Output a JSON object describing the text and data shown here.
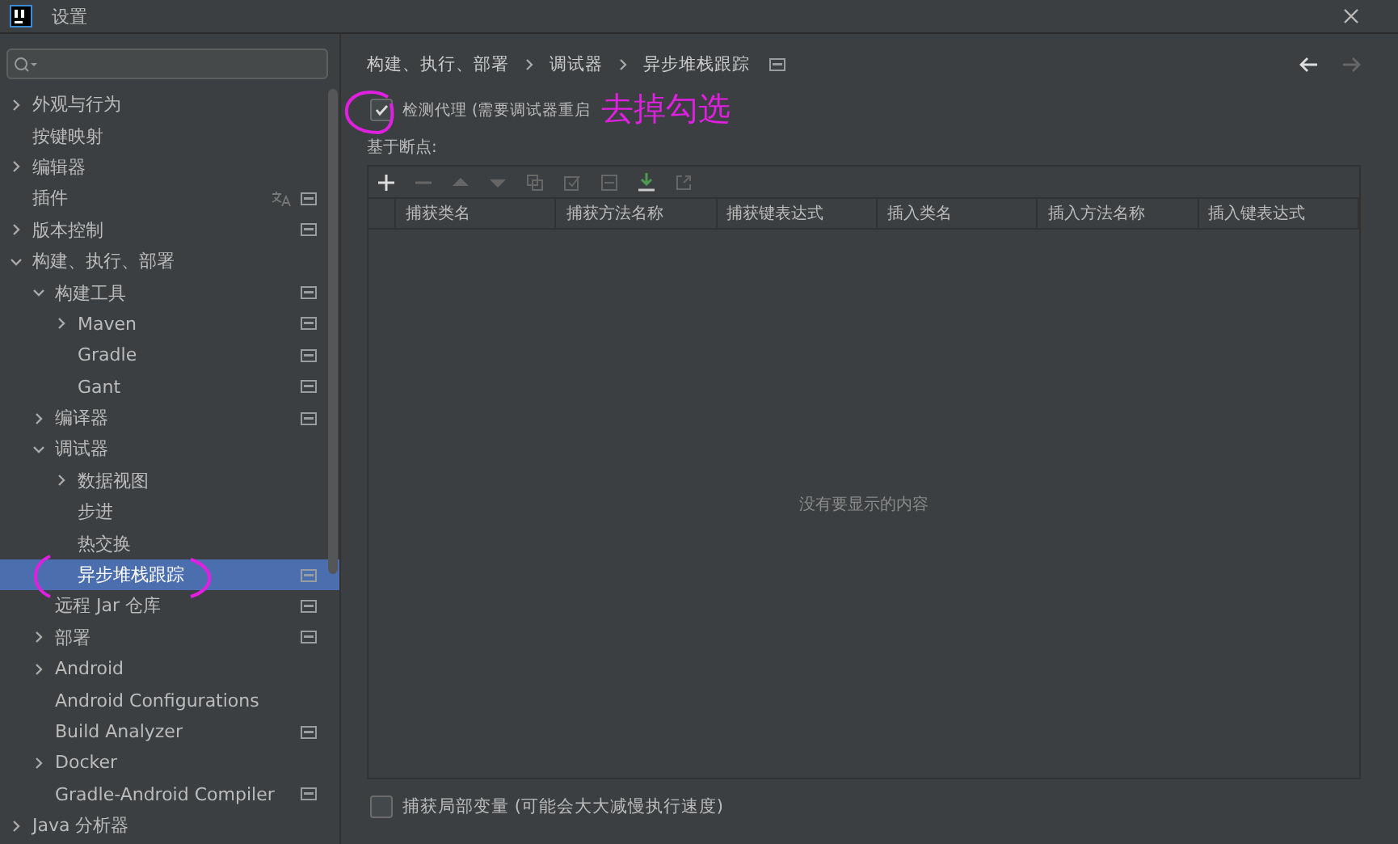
{
  "window": {
    "title": "设置"
  },
  "sidebar": {
    "items": [
      {
        "label": "外观与行为",
        "expanded": false,
        "selected": false,
        "scoped": false
      },
      {
        "label": "按键映射",
        "selected": false,
        "scoped": false
      },
      {
        "label": "编辑器",
        "expanded": false,
        "selected": false,
        "scoped": false
      },
      {
        "label": "插件",
        "selected": false,
        "scoped": true,
        "localized": true
      },
      {
        "label": "版本控制",
        "expanded": false,
        "selected": false,
        "scoped": true
      },
      {
        "label": "构建、执行、部署",
        "expanded": true,
        "selected": false,
        "scoped": false,
        "children": [
          {
            "label": "构建工具",
            "expanded": true,
            "selected": false,
            "scoped": true,
            "children": [
              {
                "label": "Maven",
                "expanded": false,
                "selected": false,
                "scoped": true
              },
              {
                "label": "Gradle",
                "selected": false,
                "scoped": true
              },
              {
                "label": "Gant",
                "selected": false,
                "scoped": true
              }
            ]
          },
          {
            "label": "编译器",
            "expanded": false,
            "selected": false,
            "scoped": true
          },
          {
            "label": "调试器",
            "expanded": true,
            "selected": false,
            "scoped": false,
            "children": [
              {
                "label": "数据视图",
                "expanded": false,
                "selected": false,
                "scoped": false
              },
              {
                "label": "步进",
                "selected": false,
                "scoped": false
              },
              {
                "label": "热交换",
                "selected": false,
                "scoped": false
              },
              {
                "label": "异步堆栈跟踪",
                "selected": true,
                "scoped": true
              }
            ]
          },
          {
            "label": "远程 Jar 仓库",
            "selected": false,
            "scoped": true
          },
          {
            "label": "部署",
            "expanded": false,
            "selected": false,
            "scoped": true
          },
          {
            "label": "Android",
            "expanded": false,
            "selected": false,
            "scoped": false
          },
          {
            "label": "Android Configurations",
            "selected": false,
            "scoped": false
          },
          {
            "label": "Build Analyzer",
            "selected": false,
            "scoped": true
          },
          {
            "label": "Docker",
            "expanded": false,
            "selected": false,
            "scoped": false
          },
          {
            "label": "Gradle-Android Compiler",
            "selected": false,
            "scoped": true
          }
        ]
      },
      {
        "label": "Java 分析器",
        "expanded": false,
        "selected": false,
        "scoped": false
      }
    ]
  },
  "breadcrumb": [
    "构建、执行、部署",
    "调试器",
    "异步堆栈跟踪"
  ],
  "agent_checkbox": {
    "label": "检测代理 (需要调试器重启",
    "checked": true
  },
  "section_label": "基于断点:",
  "table": {
    "columns": [
      "捕获类名",
      "捕获方法名称",
      "捕获键表达式",
      "插入类名",
      "插入方法名称",
      "插入键表达式"
    ],
    "empty_text": "没有要显示的内容"
  },
  "locals_checkbox": {
    "label": "捕获局部变量 (可能会大大减慢执行速度)",
    "checked": false
  },
  "annotation": {
    "text": "去掉勾选"
  }
}
